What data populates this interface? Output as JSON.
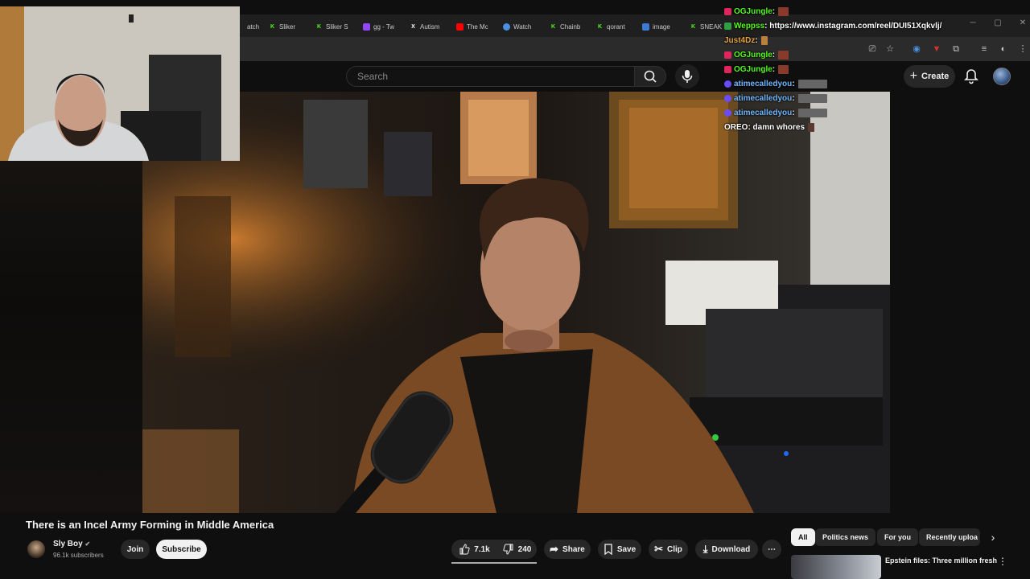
{
  "browser": {
    "tabs": [
      {
        "label": "atch",
        "icon": "globe-icon",
        "color": "#888888"
      },
      {
        "label": "Sliker",
        "icon": "kick-icon",
        "color": "#53fc18"
      },
      {
        "label": "Sliker S",
        "icon": "kick-icon",
        "color": "#53fc18"
      },
      {
        "label": "gg - Tw",
        "icon": "twitch-icon",
        "color": "#9146ff"
      },
      {
        "label": "Autism",
        "icon": "x-icon",
        "color": "#ffffff"
      },
      {
        "label": "The Mc",
        "icon": "youtube-icon",
        "color": "#ff0000"
      },
      {
        "label": "Watch",
        "icon": "globe-icon",
        "color": "#4a90e2"
      },
      {
        "label": "Chainb",
        "icon": "kick-icon",
        "color": "#53fc18"
      },
      {
        "label": "qorant",
        "icon": "kick-icon",
        "color": "#53fc18"
      },
      {
        "label": "image",
        "icon": "image-icon",
        "color": "#3a7bd5"
      },
      {
        "label": "SNEAK",
        "icon": "kick-icon",
        "color": "#53fc18"
      }
    ]
  },
  "youtube": {
    "search_placeholder": "Search",
    "create_label": "Create"
  },
  "chat": [
    {
      "user": "OGJungle",
      "message": ":",
      "color": "#53fc18",
      "badge": "#e0245e"
    },
    {
      "user": "Weppss",
      "message": ": https://www.instagram.com/reel/DUI51Xqkvlj/",
      "color": "#53fc18",
      "badge": "#2ea043"
    },
    {
      "user": "Just4Dz",
      "message": ":",
      "color": "#e8a33d",
      "badge": ""
    },
    {
      "user": "OGJungle",
      "message": ":",
      "color": "#53fc18",
      "badge": "#e0245e"
    },
    {
      "user": "OGJungle",
      "message": ":",
      "color": "#53fc18",
      "badge": "#e0245e"
    },
    {
      "user": "atimecalledyou",
      "message": ":",
      "color": "#6fb7ff",
      "badge": "#6a4cff"
    },
    {
      "user": "atimecalledyou",
      "message": ":",
      "color": "#6fb7ff",
      "badge": "#6a4cff"
    },
    {
      "user": "atimecalledyou",
      "message": ":",
      "color": "#6fb7ff",
      "badge": "#6a4cff"
    },
    {
      "user": "OREO",
      "message": ": damn whores",
      "color": "#ffffff",
      "badge": ""
    }
  ],
  "video": {
    "title": "There is an Incel Army Forming in Middle America",
    "channel": "Sly Boy",
    "subscribers": "96.1k subscribers",
    "join_label": "Join",
    "subscribe_label": "Subscribe",
    "likes": "7.1k",
    "dislikes": "240",
    "share_label": "Share",
    "save_label": "Save",
    "clip_label": "Clip",
    "download_label": "Download"
  },
  "chips": [
    "All",
    "Politics news",
    "For you",
    "Recently uploa"
  ],
  "recommended": {
    "first_title": "Epstein files: Three million fresh"
  }
}
